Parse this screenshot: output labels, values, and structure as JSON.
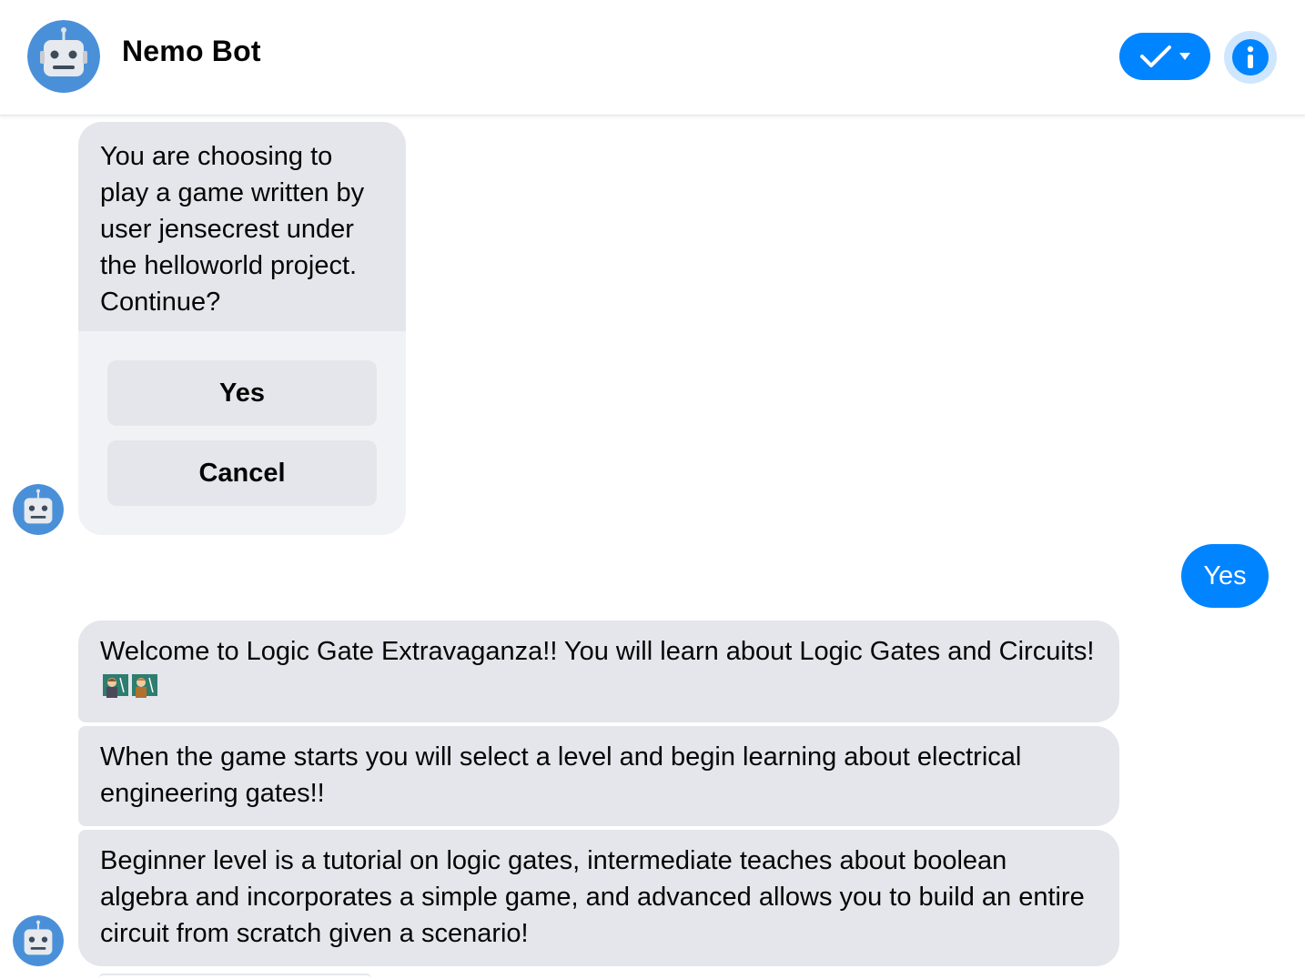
{
  "header": {
    "title": "Nemo Bot",
    "avatar_icon": "robot-icon",
    "check_icon": "checkmark-icon",
    "info_icon": "info-icon",
    "accent_color": "#0084ff"
  },
  "card": {
    "text": "You are choosing to play a game written by user jensecrest under the helloworld project. Continue?",
    "buttons": [
      {
        "label": "Yes"
      },
      {
        "label": "Cancel"
      }
    ]
  },
  "user_message": {
    "text": "Yes"
  },
  "bot_messages": [
    {
      "text": "Welcome to Logic Gate Extravaganza!! You will learn about Logic Gates and Circuits!",
      "emojis": [
        "teacher-emoji",
        "teacher-emoji"
      ]
    },
    {
      "text": "When the game starts you will select a level and begin learning about electrical engineering gates!!"
    },
    {
      "text": "Beginner level is a tutorial on logic gates, intermediate teaches about boolean algebra and incorporates a simple game, and advanced allows you to build an entire circuit from scratch given a scenario!"
    }
  ],
  "colors": {
    "bubble_gray": "#e4e6eb",
    "card_bg": "#f0f2f5",
    "user_bubble": "#0084ff",
    "avatar_blue": "#4a90d9"
  }
}
